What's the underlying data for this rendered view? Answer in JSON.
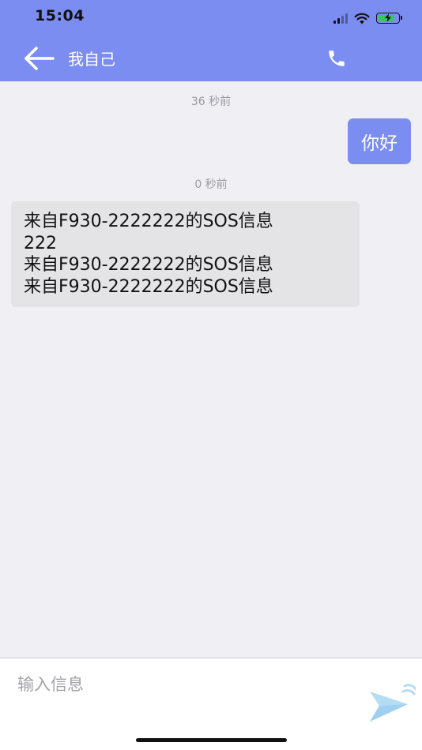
{
  "status_bar": {
    "time": "15:04"
  },
  "nav": {
    "title": "我自己",
    "back_icon": "arrow-left-icon",
    "call_icon": "phone-icon"
  },
  "messages": [
    {
      "timestamp": "36 秒前",
      "direction": "outgoing",
      "text": "你好"
    },
    {
      "timestamp": "0 秒前",
      "direction": "incoming",
      "lines": [
        "来自F930-2222222的SOS信息",
        "222",
        "来自F930-2222222的SOS信息",
        "来自F930-2222222的SOS信息"
      ]
    }
  ],
  "composer": {
    "placeholder": "输入信息",
    "value": "",
    "send_icon": "send-icon"
  },
  "colors": {
    "accent": "#7b8df0",
    "background": "#efeff4",
    "incoming_bubble": "#e4e4e7"
  }
}
